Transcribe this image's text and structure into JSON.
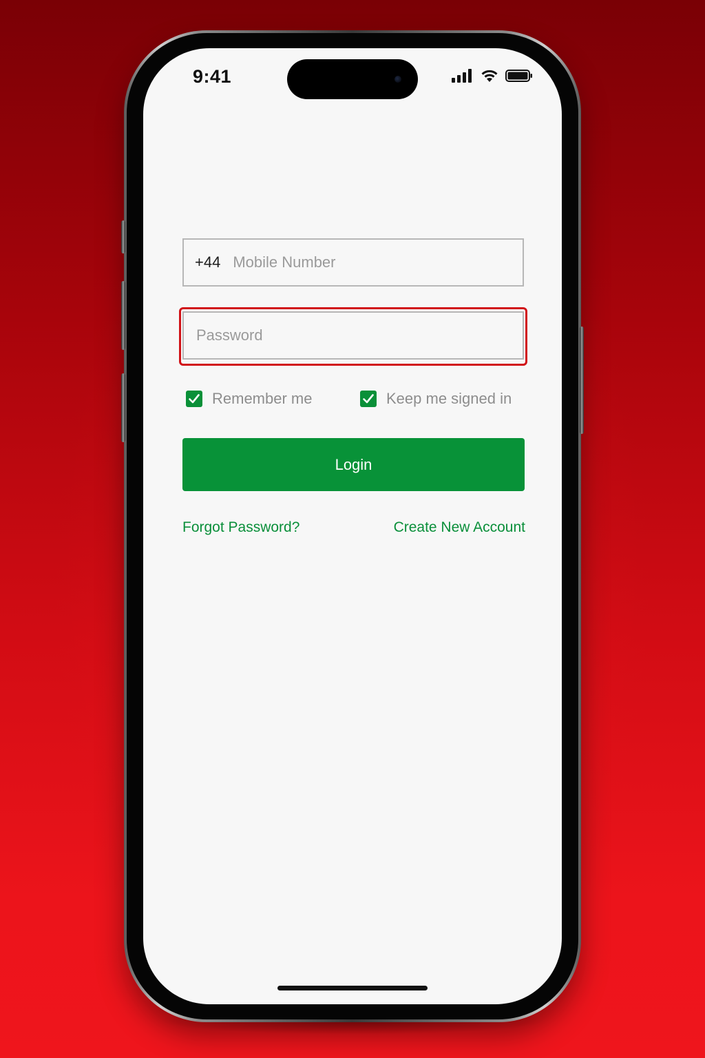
{
  "status_bar": {
    "time": "9:41",
    "icons": [
      "signal-icon",
      "wifi-icon",
      "battery-icon"
    ]
  },
  "form": {
    "country_code": "+44",
    "mobile_placeholder": "Mobile Number",
    "mobile_value": "",
    "password_placeholder": "Password",
    "password_value": "",
    "remember_me_label": "Remember me",
    "remember_me_checked": true,
    "keep_signed_in_label": "Keep me signed in",
    "keep_signed_in_checked": true,
    "login_label": "Login",
    "forgot_password_label": "Forgot Password?",
    "create_account_label": "Create New Account"
  },
  "colors": {
    "background": "#d20c14",
    "accent_green": "#089238",
    "highlight_red": "#d11318",
    "screen_bg": "#f7f7f7"
  }
}
